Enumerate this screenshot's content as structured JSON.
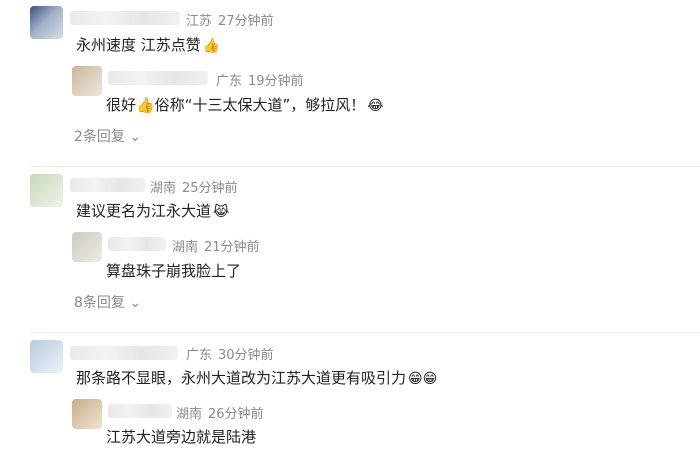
{
  "comments": [
    {
      "location": "江苏",
      "time": "27分钟前",
      "text": "永州速度 江苏点赞",
      "emoji": "👍",
      "reply": {
        "location": "广东",
        "time": "19分钟前",
        "text": "很好👍俗称“十三太保大道”，够拉风！",
        "emoji": "😂"
      },
      "more": "2条回复"
    },
    {
      "location": "湖南",
      "time": "25分钟前",
      "text": "建议更名为江永大道",
      "emoji": "😹",
      "reply": {
        "location": "湖南",
        "time": "21分钟前",
        "text": "算盘珠子崩我脸上了",
        "emoji": ""
      },
      "more": "8条回复"
    },
    {
      "location": "广东",
      "time": "30分钟前",
      "text": "那条路不显眼，永州大道改为江苏大道更有吸引力",
      "emoji": "😁😁",
      "reply": {
        "location": "湖南",
        "time": "26分钟前",
        "text": "江苏大道旁边就是陆港",
        "emoji": ""
      }
    }
  ],
  "icons": {
    "chevron": "chevron-down-icon"
  }
}
